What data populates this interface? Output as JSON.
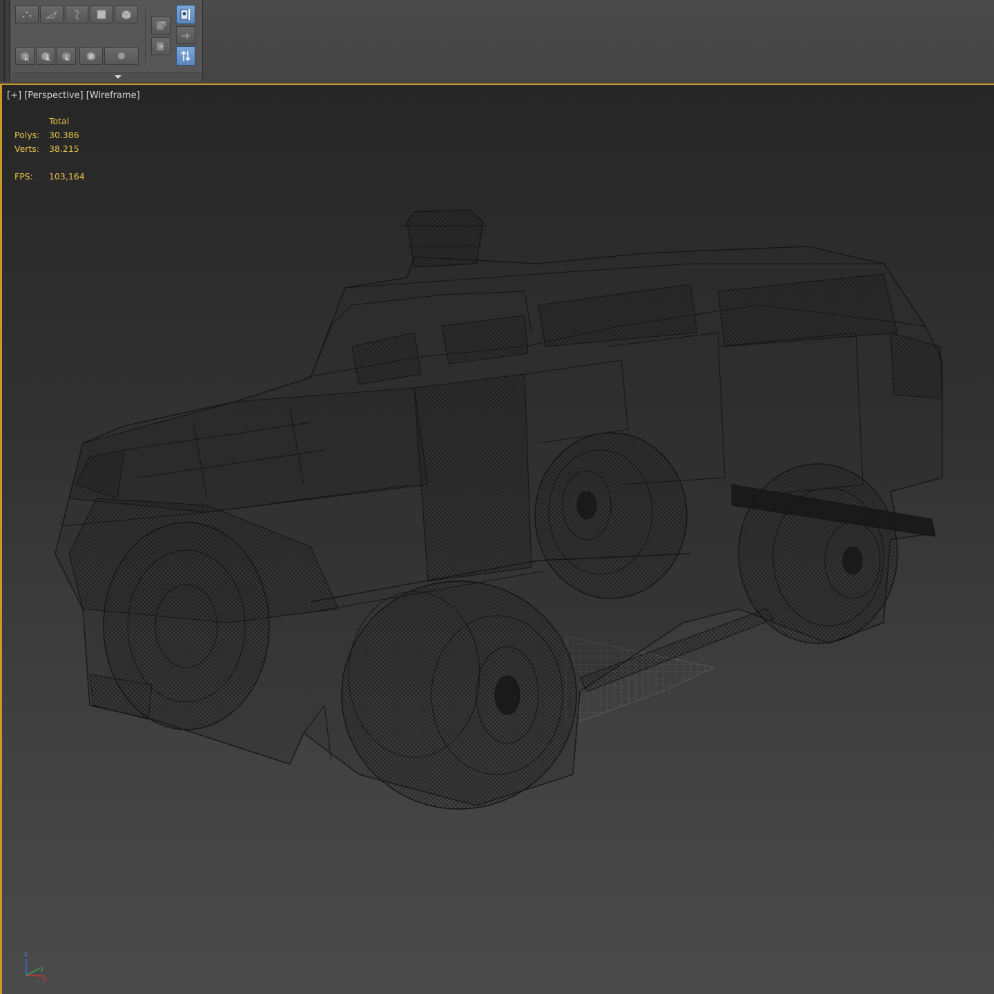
{
  "toolbar": {
    "row1_buttons": [
      "vertex-icon",
      "edge-icon",
      "border-icon",
      "polygon-icon",
      "element-icon"
    ],
    "row2_buttons": [
      "select-by-vertex-icon",
      "ignore-backfacing-icon",
      "by-angle-icon",
      "shrink-grow-icon",
      "preview-selection-icon"
    ],
    "side_buttons": [
      "copy-selection-icon",
      "paste-selection-icon"
    ],
    "right_buttons": [
      "named-selection-icon",
      "pin-icon",
      "sort-icon"
    ],
    "accent_color": "#6a95cc"
  },
  "viewport": {
    "label_plus": "[+]",
    "label_view": "[Perspective]",
    "label_shading": "[Wireframe]",
    "border_color": "#c89a2a",
    "stats": {
      "header": "Total",
      "polys_label": "Polys:",
      "polys_value": "30.386",
      "verts_label": "Verts:",
      "verts_value": "38.215",
      "fps_label": "FPS:",
      "fps_value": "103,164"
    },
    "model": "armored 6x6 vehicle wireframe",
    "axis": {
      "z": "z",
      "x": "x",
      "y": "y"
    }
  }
}
